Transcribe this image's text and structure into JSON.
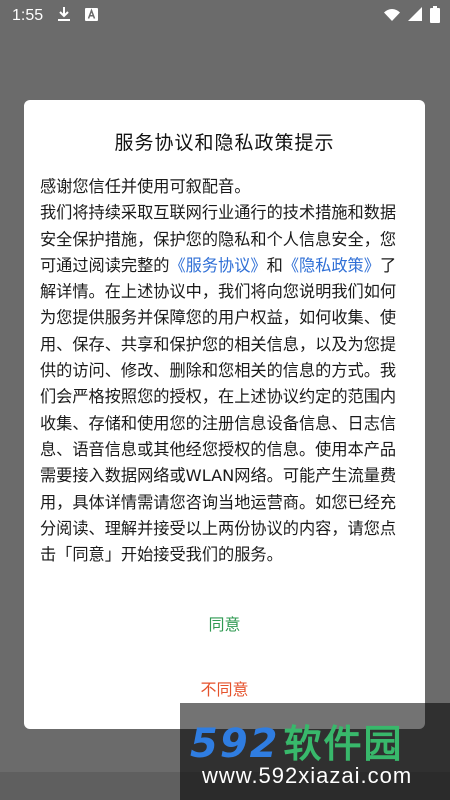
{
  "status_bar": {
    "time": "1:55",
    "icons": [
      "download-icon",
      "keyboard-a-icon",
      "wifi-icon",
      "signal-icon",
      "battery-icon"
    ]
  },
  "dialog": {
    "title": "服务协议和隐私政策提示",
    "paragraph1": "感谢您信任并使用可叙配音。",
    "text_before_links": "我们将持续采取互联网行业通行的技术措施和数据安全保护措施，保护您的隐私和个人信息安全，您可通过阅读完整的",
    "link_service": "《服务协议》",
    "text_and": "和",
    "link_privacy": "《隐私政策》",
    "text_after_links": "了解详情。在上述协议中，我们将向您说明我们如何为您提供服务并保障您的用户权益，如何收集、使用、保存、共享和保护您的相关信息，以及为您提供的访问、修改、删除和您相关的信息的方式。我们会严格按照您的授权，在上述协议约定的范围内收集、存储和使用您的注册信息设备信息、日志信息、语音信息或其他经您授权的信息。使用本产品需要接入数据网络或WLAN网络。可能产生流量费用，具体详情需请您咨询当地运营商。如您已经充分阅读、理解并接受以上两份协议的内容，请您点击「同意」开始接受我们的服务。",
    "agree_label": "同意",
    "disagree_label": "不同意"
  },
  "watermark": {
    "logo_number": "592",
    "logo_text": "软件园",
    "url": "www.592xiazai.com"
  },
  "colors": {
    "link": "#2f6fd6",
    "agree": "#2f9a52",
    "disagree": "#e5522c"
  }
}
